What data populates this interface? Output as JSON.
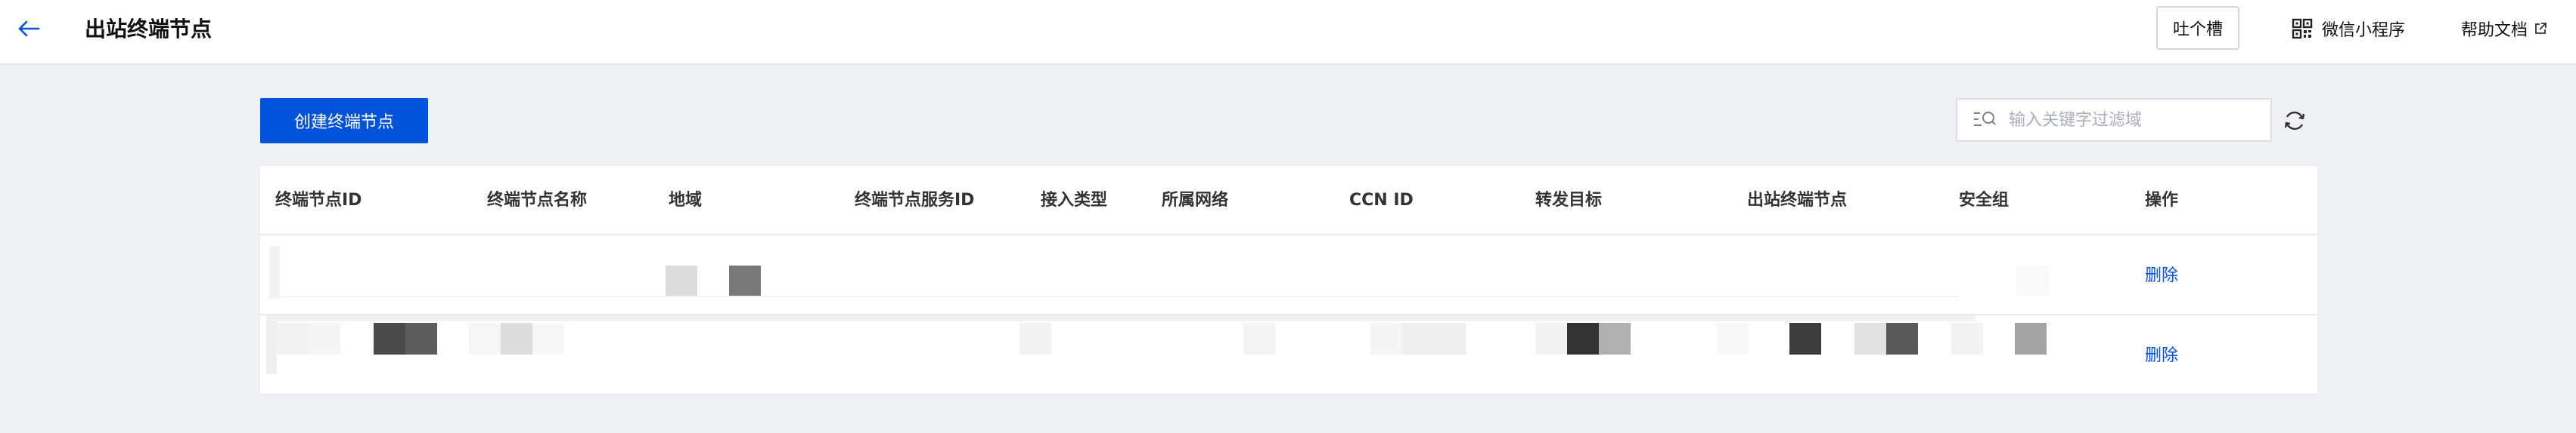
{
  "header": {
    "title": "出站终端节点",
    "feedback_label": "吐个槽",
    "mini_program_label": "微信小程序",
    "help_label": "帮助文档"
  },
  "toolbar": {
    "create_label": "创建终端节点",
    "search_placeholder": "输入关键字过滤域"
  },
  "table": {
    "columns": [
      "终端节点ID",
      "终端节点名称",
      "地域",
      "终端节点服务ID",
      "接入类型",
      "所属网络",
      "CCN ID",
      "转发目标",
      "出站终端节点",
      "安全组",
      "操作"
    ],
    "rows": [
      {
        "action": "删除"
      },
      {
        "action": "删除"
      }
    ]
  },
  "colors": {
    "primary": "#0052d9",
    "background": "#f0f1f5"
  }
}
